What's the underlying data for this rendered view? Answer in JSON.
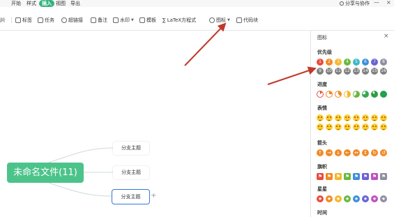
{
  "menubar": {
    "items": [
      "开始",
      "样式",
      "插入",
      "视图",
      "导出"
    ],
    "active_index": 2,
    "share_label": "分享与协作",
    "minimize": "—",
    "close": "×"
  },
  "toolbar": {
    "items": [
      {
        "label": "图片",
        "icon": "image-icon"
      },
      {
        "label": "标签",
        "icon": "tag-icon"
      },
      {
        "label": "任务",
        "icon": "task-icon"
      },
      {
        "label": "超链接",
        "icon": "link-icon"
      },
      {
        "label": "备注",
        "icon": "note-icon"
      },
      {
        "label": "水印",
        "icon": "watermark-icon"
      },
      {
        "label": "模板",
        "icon": "template-icon"
      },
      {
        "label": "LaTeX方程式",
        "icon": "formula-icon"
      },
      {
        "label": "图标",
        "icon": "emoji-icon"
      },
      {
        "label": "代码块",
        "icon": "code-icon"
      }
    ]
  },
  "mindmap": {
    "root": "未命名文件(11)",
    "children": [
      "分支主题",
      "分支主题",
      "分支主题"
    ],
    "selected_index": 2,
    "add_label": "+"
  },
  "panel": {
    "title": "图标",
    "close": "×",
    "sections": {
      "priority": "优先级",
      "progress": "进度",
      "expression": "表情",
      "arrow": "箭头",
      "flag": "旗帜",
      "star": "星星",
      "more": "时间"
    },
    "priority_icons": [
      "1",
      "2",
      "3",
      "4",
      "5",
      "6",
      "7",
      "8",
      "9",
      "10",
      "11",
      "12",
      "13",
      "14",
      "15",
      "16"
    ],
    "priority_colors": [
      "#e94b3c",
      "#f08a24",
      "#f5b82e",
      "#68b93e",
      "#3cb8c7",
      "#3d8fd9",
      "#6a62d4",
      "#8e8ea0",
      "#808080",
      "#808080",
      "#808080",
      "#808080",
      "#808080",
      "#808080",
      "#808080",
      "#808080"
    ],
    "arrow_glyphs": [
      "↑",
      "→",
      "↓",
      "←",
      "↔",
      "↕",
      "↻",
      "↺"
    ],
    "flag_colors": [
      "#e94b3c",
      "#f08a24",
      "#f5b82e",
      "#68b93e",
      "#3d8fd9",
      "#6a62d4",
      "#c04fc2",
      "#8e8ea0"
    ],
    "star_colors": [
      "#e94b3c",
      "#f08a24",
      "#f5b82e",
      "#68b93e",
      "#3d8fd9",
      "#6a62d4",
      "#c04fc2",
      "#8e8ea0"
    ],
    "progress_colors": [
      "#e94b3c",
      "#f08a24",
      "#f08a24",
      "#f5b82e",
      "#68b93e",
      "#35a853",
      "#2d9e44",
      "#22a04a"
    ]
  },
  "colors": {
    "accent": "#36b37e",
    "root_node": "#4cc38a",
    "selection": "#3478d6",
    "annotation_arrow": "#c0392b"
  }
}
